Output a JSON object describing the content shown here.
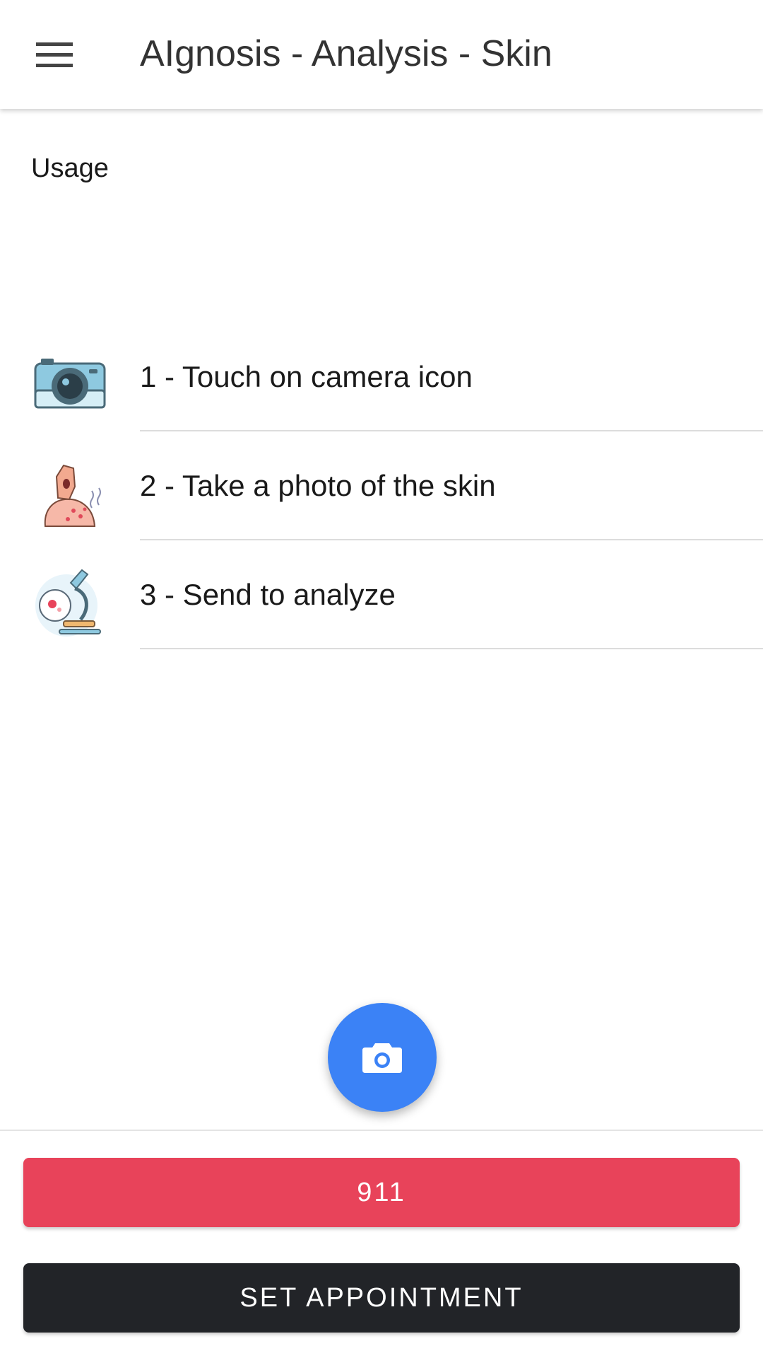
{
  "app_bar": {
    "title": "AIgnosis - Analysis - Skin",
    "menu_icon": "hamburger-menu-icon"
  },
  "usage": {
    "heading": "Usage",
    "steps": [
      {
        "label": "1 - Touch on camera icon",
        "icon": "camera-illustration-icon"
      },
      {
        "label": "2 - Take a photo of the skin",
        "icon": "skin-rash-illustration-icon"
      },
      {
        "label": "3 - Send to analyze",
        "icon": "microscope-illustration-icon"
      }
    ]
  },
  "fab": {
    "icon": "camera-icon"
  },
  "actions": {
    "emergency_label": "911",
    "appointment_label": "SET APPOINTMENT"
  },
  "colors": {
    "accent": "#3b82f6",
    "emergency": "#e8435a",
    "appointment": "#222428"
  }
}
